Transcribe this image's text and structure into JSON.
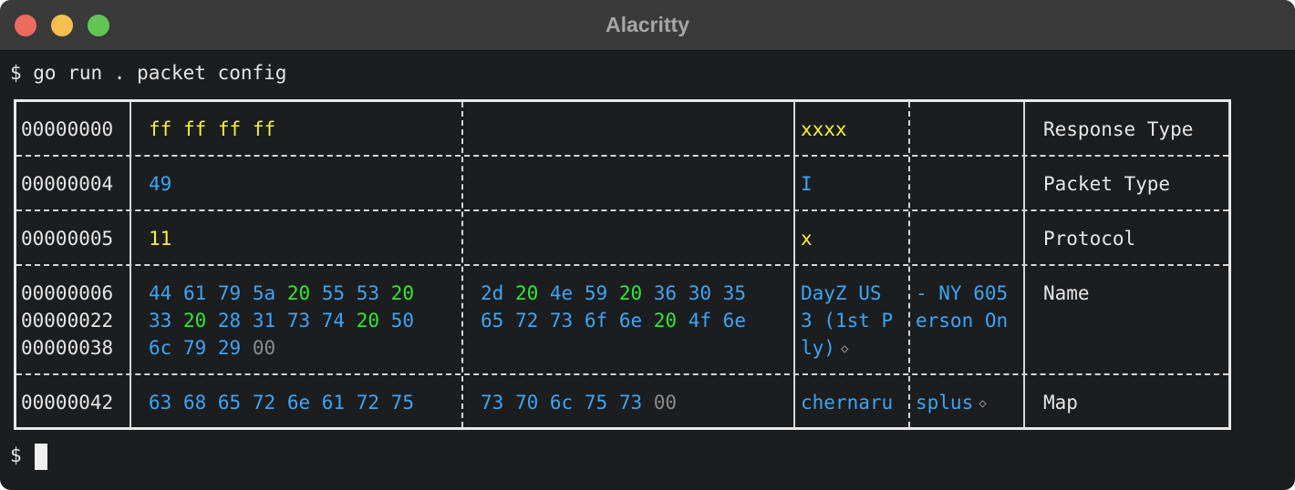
{
  "window": {
    "title": "Alacritty"
  },
  "terminal": {
    "command_line": "$ go run . packet config",
    "prompt": "$"
  },
  "rows": [
    {
      "offsets": [
        "00000000"
      ],
      "hex1": [
        [
          {
            "t": "ff",
            "c": "y"
          },
          {
            "t": "ff",
            "c": "y"
          },
          {
            "t": "ff",
            "c": "y"
          },
          {
            "t": "ff",
            "c": "y"
          }
        ]
      ],
      "hex2": [
        []
      ],
      "ascii1": [
        [
          {
            "t": "xxxx",
            "c": "y"
          }
        ]
      ],
      "ascii2": [
        []
      ],
      "label": "Response Type"
    },
    {
      "offsets": [
        "00000004"
      ],
      "hex1": [
        [
          {
            "t": "49",
            "c": "b"
          }
        ]
      ],
      "hex2": [
        []
      ],
      "ascii1": [
        [
          {
            "t": "I",
            "c": "b"
          }
        ]
      ],
      "ascii2": [
        []
      ],
      "label": "Packet Type"
    },
    {
      "offsets": [
        "00000005"
      ],
      "hex1": [
        [
          {
            "t": "11",
            "c": "y"
          }
        ]
      ],
      "hex2": [
        []
      ],
      "ascii1": [
        [
          {
            "t": "x",
            "c": "y"
          }
        ]
      ],
      "ascii2": [
        []
      ],
      "label": "Protocol"
    },
    {
      "offsets": [
        "00000006",
        "00000022",
        "00000038"
      ],
      "hex1": [
        [
          {
            "t": "44",
            "c": "b"
          },
          {
            "t": "61",
            "c": "b"
          },
          {
            "t": "79",
            "c": "b"
          },
          {
            "t": "5a",
            "c": "b"
          },
          {
            "t": "20",
            "c": "g"
          },
          {
            "t": "55",
            "c": "b"
          },
          {
            "t": "53",
            "c": "b"
          },
          {
            "t": "20",
            "c": "g"
          }
        ],
        [
          {
            "t": "33",
            "c": "b"
          },
          {
            "t": "20",
            "c": "g"
          },
          {
            "t": "28",
            "c": "b"
          },
          {
            "t": "31",
            "c": "b"
          },
          {
            "t": "73",
            "c": "b"
          },
          {
            "t": "74",
            "c": "b"
          },
          {
            "t": "20",
            "c": "g"
          },
          {
            "t": "50",
            "c": "b"
          }
        ],
        [
          {
            "t": "6c",
            "c": "b"
          },
          {
            "t": "79",
            "c": "b"
          },
          {
            "t": "29",
            "c": "b"
          },
          {
            "t": "00",
            "c": "k"
          }
        ]
      ],
      "hex2": [
        [
          {
            "t": "2d",
            "c": "b"
          },
          {
            "t": "20",
            "c": "g"
          },
          {
            "t": "4e",
            "c": "b"
          },
          {
            "t": "59",
            "c": "b"
          },
          {
            "t": "20",
            "c": "g"
          },
          {
            "t": "36",
            "c": "b"
          },
          {
            "t": "30",
            "c": "b"
          },
          {
            "t": "35",
            "c": "b"
          }
        ],
        [
          {
            "t": "65",
            "c": "b"
          },
          {
            "t": "72",
            "c": "b"
          },
          {
            "t": "73",
            "c": "b"
          },
          {
            "t": "6f",
            "c": "b"
          },
          {
            "t": "6e",
            "c": "b"
          },
          {
            "t": "20",
            "c": "g"
          },
          {
            "t": "4f",
            "c": "b"
          },
          {
            "t": "6e",
            "c": "b"
          }
        ],
        []
      ],
      "ascii1": [
        [
          {
            "t": "DayZ US ",
            "c": "b"
          }
        ],
        [
          {
            "t": "3 (1st P",
            "c": "b"
          }
        ],
        [
          {
            "t": "ly)",
            "c": "b"
          },
          {
            "t": "◇",
            "c": "dia"
          }
        ]
      ],
      "ascii2": [
        [
          {
            "t": "- NY 605",
            "c": "b"
          }
        ],
        [
          {
            "t": "erson On",
            "c": "b"
          }
        ],
        []
      ],
      "label": "Name"
    },
    {
      "offsets": [
        "00000042"
      ],
      "hex1": [
        [
          {
            "t": "63",
            "c": "b"
          },
          {
            "t": "68",
            "c": "b"
          },
          {
            "t": "65",
            "c": "b"
          },
          {
            "t": "72",
            "c": "b"
          },
          {
            "t": "6e",
            "c": "b"
          },
          {
            "t": "61",
            "c": "b"
          },
          {
            "t": "72",
            "c": "b"
          },
          {
            "t": "75",
            "c": "b"
          }
        ]
      ],
      "hex2": [
        [
          {
            "t": "73",
            "c": "b"
          },
          {
            "t": "70",
            "c": "b"
          },
          {
            "t": "6c",
            "c": "b"
          },
          {
            "t": "75",
            "c": "b"
          },
          {
            "t": "73",
            "c": "b"
          },
          {
            "t": "00",
            "c": "k"
          }
        ]
      ],
      "ascii1": [
        [
          {
            "t": "chernaru",
            "c": "b"
          }
        ]
      ],
      "ascii2": [
        [
          {
            "t": "splus",
            "c": "b"
          },
          {
            "t": "◇",
            "c": "dia"
          }
        ]
      ],
      "label": "Map"
    }
  ],
  "colors": {
    "background": "#1c1d1f",
    "titlebar": "#3a3a3a",
    "yellow": "#f2f23a",
    "blue": "#3ba5f5",
    "green": "#2ee82e",
    "gray": "#8a8a8a",
    "text": "#e6e6e6"
  }
}
